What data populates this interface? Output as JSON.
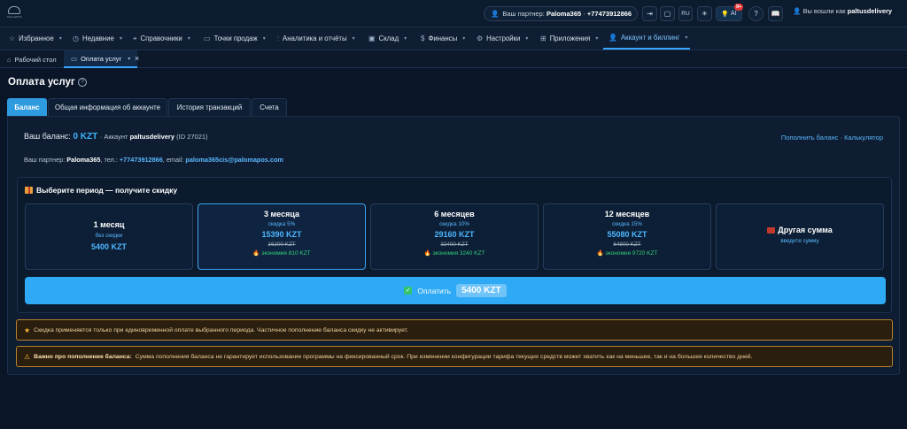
{
  "topbar": {
    "logo_text": "PalomaPOS",
    "partner_label": "Ваш партнер:",
    "partner_name": "Paloma365",
    "partner_phone": "+77473912866",
    "lang": "RU",
    "ai_label": "AI",
    "ai_badge": "9+",
    "user_label": "Вы вошли как",
    "user_name": "paltusdelivery"
  },
  "nav": {
    "items": [
      {
        "label": "Избранное",
        "icon": "star-icon"
      },
      {
        "label": "Недавние",
        "icon": "clock-icon"
      },
      {
        "label": "Справочники",
        "icon": "tag-icon"
      },
      {
        "label": "Точки продаж",
        "icon": "monitor-icon"
      },
      {
        "label": "Аналитика и отчёты",
        "icon": "chart-icon"
      },
      {
        "label": "Склад",
        "icon": "box-icon"
      },
      {
        "label": "Финансы",
        "icon": "dollar-icon"
      },
      {
        "label": "Настройки",
        "icon": "gear-icon"
      },
      {
        "label": "Приложения",
        "icon": "grid-icon"
      },
      {
        "label": "Аккаунт и биллинг",
        "icon": "user-icon"
      }
    ]
  },
  "page_tabs": [
    {
      "label": "Рабочий стол"
    },
    {
      "label": "Оплата услуг"
    }
  ],
  "page": {
    "title": "Оплата услуг"
  },
  "content_tabs": [
    {
      "label": "Баланс"
    },
    {
      "label": "Общая информация об аккаунте"
    },
    {
      "label": "История транзакций"
    },
    {
      "label": "Счета"
    }
  ],
  "balance": {
    "label": "Ваш баланс:",
    "value": "0 KZT",
    "account_prefix": "· Аккаунт",
    "account_name": "paltusdelivery",
    "account_id": "(ID 27021)",
    "topup_link": "Пополнить баланс · Калькулятор",
    "partner_label": "Ваш партнер:",
    "partner_name": "Paloma365",
    "phone_label": ", тел.:",
    "phone": "+77473912866",
    "email_label": ", email:",
    "email": "paloma365cis@palomapos.com"
  },
  "period": {
    "title": "Выберите период — получите скидку",
    "cards": [
      {
        "title": "1 месяц",
        "sub": "без скидки",
        "price": "5400 KZT"
      },
      {
        "title": "3 месяца",
        "sub": "скидка 5%",
        "price": "15390 KZT",
        "old": "16200 KZT",
        "save": "экономия 810 KZT"
      },
      {
        "title": "6 месяцев",
        "sub": "скидка 10%",
        "price": "29160 KZT",
        "old": "32400 KZT",
        "save": "экономия 3240 KZT"
      },
      {
        "title": "12 месяцев",
        "sub": "скидка 15%",
        "price": "55080 KZT",
        "old": "64800 KZT",
        "save": "экономия 9720 KZT"
      },
      {
        "title": "Другая сумма",
        "sub": "введите сумму"
      }
    ],
    "pay_label": "Оплатить",
    "pay_amount": "5400 KZT"
  },
  "notices": {
    "discount": "Скидка применяется только при единовременной оплате выбранного периода. Частичное пополнение баланса скидку не активирует.",
    "important_title": "Важно про пополнение баланса:",
    "important_text": "Сумма пополнения баланса не гарантирует использование программы на фиксированный срок. При изменении конфигурации тарифа текущих средств может хватить как на меньшее, так и на большее количество дней."
  }
}
